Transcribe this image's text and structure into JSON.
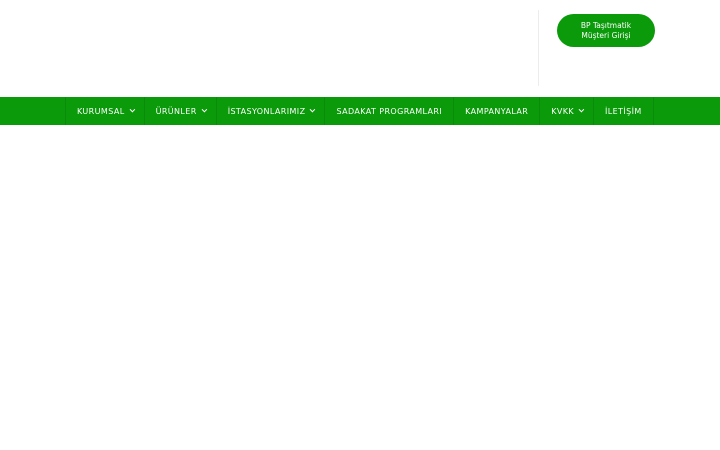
{
  "header": {
    "cta_line1": "BP Taşıtmatik",
    "cta_line2": "Müşteri Girişi",
    "accent_color": "#0a9a0a"
  },
  "nav": {
    "items": [
      {
        "label": "KURUMSAL",
        "has_dropdown": true
      },
      {
        "label": "ÜRÜNLER",
        "has_dropdown": true
      },
      {
        "label": "İSTASYONLARIMIZ",
        "has_dropdown": true
      },
      {
        "label": "SADAKAT PROGRAMLARI",
        "has_dropdown": false
      },
      {
        "label": "KAMPANYALAR",
        "has_dropdown": false
      },
      {
        "label": "KVKK",
        "has_dropdown": true
      },
      {
        "label": "İLETİŞİM",
        "has_dropdown": false
      }
    ],
    "dropdown_icon": "chevron-down-icon"
  }
}
